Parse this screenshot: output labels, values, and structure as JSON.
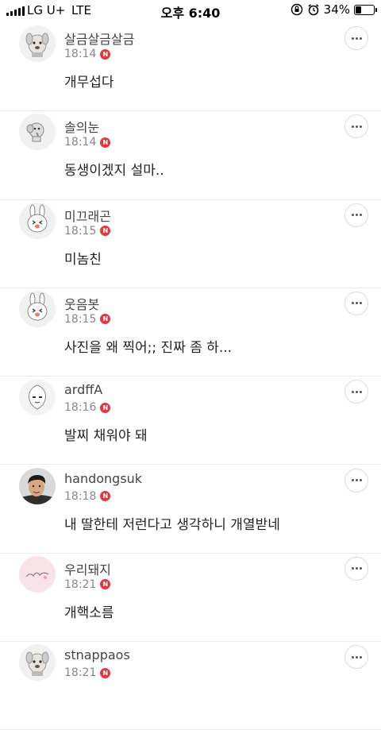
{
  "status_bar": {
    "carrier": "LG U+",
    "network": "LTE",
    "time": "오후 6:40",
    "battery_text": "34%",
    "battery_level": 0.34
  },
  "comments": [
    {
      "name": "살금살금살금",
      "time": "18:14",
      "badge": "N",
      "text": "개무섭다",
      "avatar": "dog-sticker-avatar"
    },
    {
      "name": "솔의눈",
      "time": "18:14",
      "badge": "N",
      "text": "동생이겠지 설마..",
      "avatar": "elephant-sticker-avatar"
    },
    {
      "name": "미끄래곤",
      "time": "18:15",
      "badge": "N",
      "text": "미놈친",
      "avatar": "rabbit-sticker-avatar"
    },
    {
      "name": "웃음봇",
      "time": "18:15",
      "badge": "N",
      "text": "사진을 왜 찍어;; 진짜 좀 하...",
      "avatar": "rabbit-sticker-avatar"
    },
    {
      "name": "ardffA",
      "time": "18:16",
      "badge": "N",
      "text": "발찌 채워야 돼",
      "avatar": "peach-sticker-avatar"
    },
    {
      "name": "handongsuk",
      "time": "18:18",
      "badge": "N",
      "text": "내 딸한테 저런다고 생각하니 개열받네",
      "avatar": "man-photo-avatar"
    },
    {
      "name": "우리돼지",
      "time": "18:21",
      "badge": "N",
      "text": "개핵소름",
      "avatar": "pink-handwriting-avatar"
    },
    {
      "name": "stnappaos",
      "time": "18:21",
      "badge": "N",
      "text": "",
      "avatar": "dog-sticker-avatar"
    }
  ]
}
